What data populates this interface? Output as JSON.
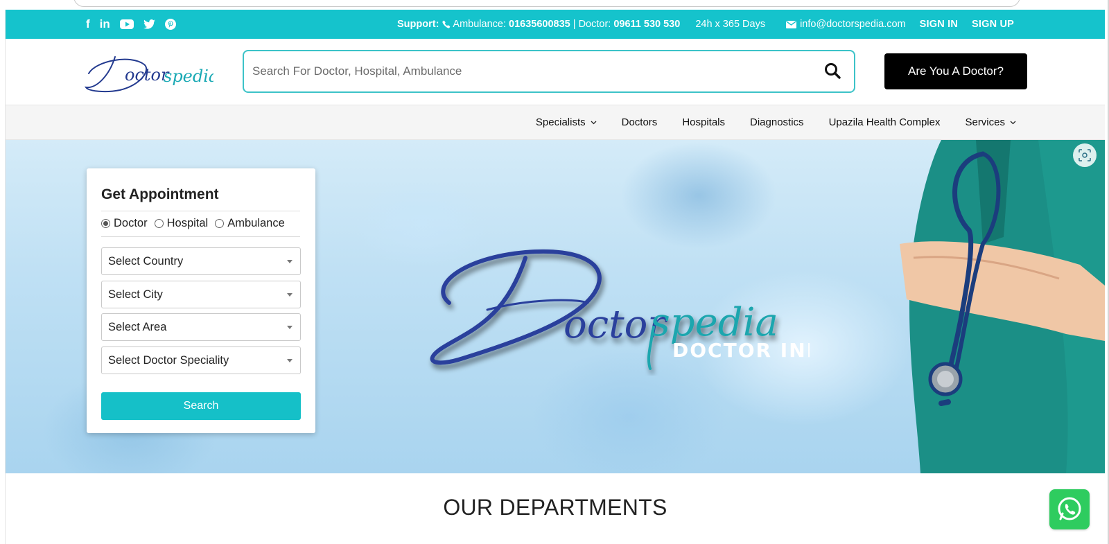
{
  "topbar": {
    "social": [
      "f",
      "in"
    ],
    "support_label": "Support:",
    "ambulance_label": "Ambulance:",
    "ambulance_number": "01635600835",
    "separator": " | ",
    "doctor_label": "Doctor:",
    "doctor_number": "09611 530 530",
    "hours": "24h x 365 Days",
    "email": "info@doctorspedia.com",
    "sign_in": "SIGN IN",
    "sign_up": "SIGN UP"
  },
  "header": {
    "logo_text": "Doctorspedia",
    "search_placeholder": "Search For Doctor, Hospital, Ambulance",
    "doctor_button": "Are You A Doctor?"
  },
  "nav": {
    "items": [
      {
        "label": "Specialists",
        "dropdown": true
      },
      {
        "label": "Doctors",
        "dropdown": false
      },
      {
        "label": "Hospitals",
        "dropdown": false
      },
      {
        "label": "Diagnostics",
        "dropdown": false
      },
      {
        "label": "Upazila Health Complex",
        "dropdown": false
      },
      {
        "label": "Services",
        "dropdown": true
      }
    ]
  },
  "appointment": {
    "title": "Get Appointment",
    "radios": [
      {
        "label": "Doctor",
        "checked": true
      },
      {
        "label": "Hospital",
        "checked": false
      },
      {
        "label": "Ambulance",
        "checked": false
      }
    ],
    "selects": [
      "Select Country",
      "Select City",
      "Select Area",
      "Select Doctor Speciality"
    ],
    "search_button": "Search"
  },
  "hero": {
    "brand_script": "Doctorspedia",
    "brand_sub": "DOCTOR INFO"
  },
  "departments": {
    "title": "OUR DEPARTMENTS"
  },
  "colors": {
    "accent": "#15c3cc",
    "brand_blue": "#2a3f9a",
    "black": "#000000"
  },
  "icons": {
    "social": [
      "facebook-icon",
      "linkedin-icon",
      "youtube-icon",
      "twitter-icon",
      "pinterest-icon"
    ],
    "phone": "phone-icon",
    "mail": "envelope-icon",
    "search": "search-icon",
    "lens": "visual-search-icon",
    "chat": "whatsapp-icon"
  }
}
